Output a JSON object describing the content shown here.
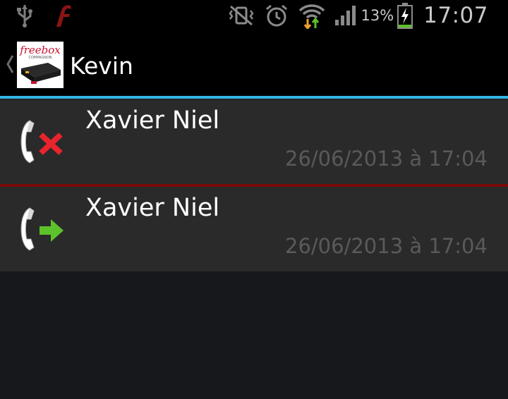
{
  "status_bar": {
    "battery_percent": "13%",
    "time": "17:07",
    "icons": [
      "usb-icon",
      "flash-icon",
      "vibrate-mute-icon",
      "alarm-icon",
      "wifi-icon",
      "signal-icon",
      "battery-charging-icon"
    ]
  },
  "action_bar": {
    "title": "Kevin",
    "logo_text": "freebox",
    "logo_subtext": "COMPAGNON"
  },
  "calls": [
    {
      "name": "Xavier Niel",
      "datetime": "26/06/2013 à 17:04",
      "type": "missed",
      "icon": "missed-call-icon"
    },
    {
      "name": "Xavier Niel",
      "datetime": "26/06/2013 à 17:04",
      "type": "outgoing",
      "icon": "outgoing-call-icon"
    }
  ],
  "colors": {
    "accent": "#33b5e5",
    "missed_divider": "#7a0a0a",
    "missed_x": "#e8242d",
    "outgoing_arrow": "#5cc12a",
    "item_bg": "#2a2a2a"
  }
}
